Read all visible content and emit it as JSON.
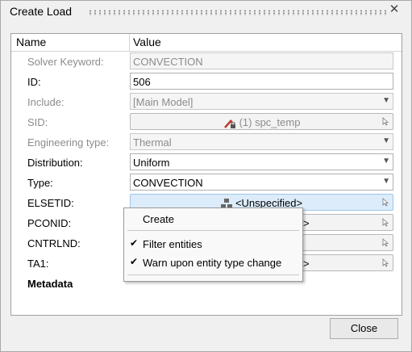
{
  "window": {
    "title": "Create Load",
    "close_icon": "close-icon"
  },
  "table": {
    "headers": {
      "name": "Name",
      "value": "Value"
    },
    "rows": [
      {
        "label": "Solver Keyword:",
        "value": "CONVECTION"
      },
      {
        "label": "ID:",
        "value": "506"
      },
      {
        "label": "Include:",
        "value": "[Main Model]"
      },
      {
        "label": "SID:",
        "value": "(1) spc_temp"
      },
      {
        "label": "Engineering type:",
        "value": "Thermal"
      },
      {
        "label": "Distribution:",
        "value": "Uniform"
      },
      {
        "label": "Type:",
        "value": "CONVECTION"
      },
      {
        "label": "ELSETID:",
        "value": "<Unspecified>"
      },
      {
        "label": "PCONID:",
        "value": ">"
      },
      {
        "label": "CNTRLND:",
        "value": ""
      },
      {
        "label": "TA1:",
        "value": ">"
      },
      {
        "label": "Metadata",
        "value": ""
      }
    ]
  },
  "context_menu": {
    "items": [
      {
        "label": "Create",
        "checked": false
      },
      {
        "label": "Filter entities",
        "checked": true
      },
      {
        "label": "Warn upon entity type change",
        "checked": true
      }
    ]
  },
  "footer": {
    "close_label": "Close"
  },
  "colors": {
    "selected_field": "#dcecfa",
    "dim_text": "#8c8c8c"
  }
}
